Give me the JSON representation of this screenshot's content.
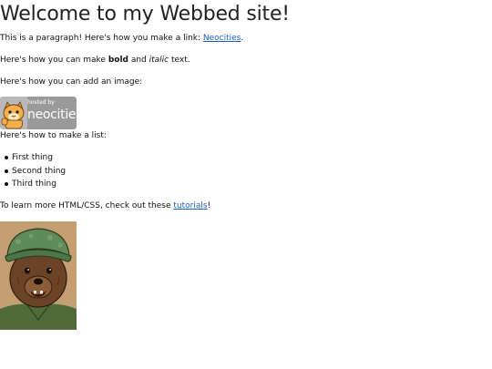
{
  "page": {
    "heading": "Welcome to my Webbed site!",
    "para_link_prefix": "This is a paragraph! Here's how you make a link: ",
    "para_link_text": "Neocities",
    "para_link_suffix": ".",
    "bold_prefix": "Here's how you can make ",
    "bold_word": "bold",
    "bold_middle": " and ",
    "italic_word": "italic",
    "bold_suffix": " text.",
    "image_intro": "Here's how you can add an image:",
    "list_intro": "Here's how to make a list:",
    "list_items": [
      "First thing",
      "Second thing",
      "Third thing"
    ],
    "learn_prefix": "To learn more HTML/CSS, check out these ",
    "learn_link_text": "tutorials",
    "learn_suffix": "!"
  },
  "badge": {
    "small_text": "hosted by",
    "big_text": "neocities"
  },
  "colors": {
    "link": "#1a5fc9",
    "badge_bg": "#9a9a9a",
    "image_bg": "#c9a57a"
  }
}
